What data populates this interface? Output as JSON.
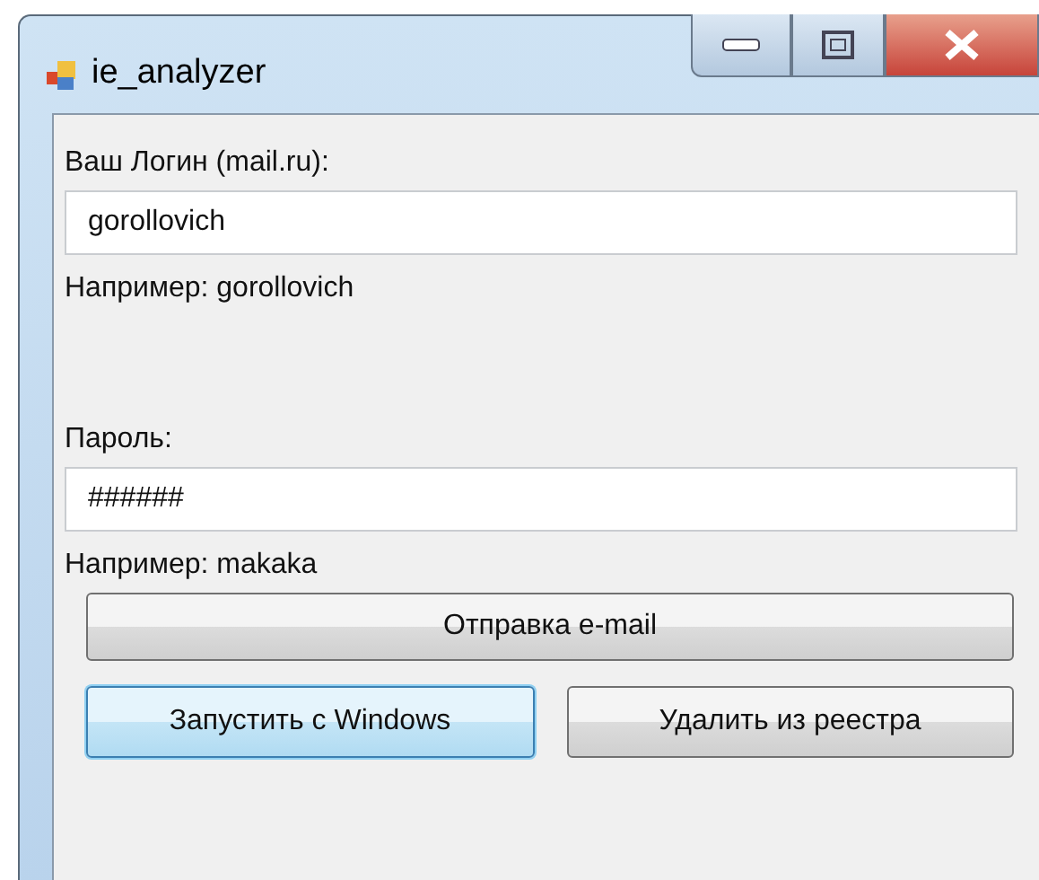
{
  "window": {
    "title": "ie_analyzer"
  },
  "fields": [
    {
      "label": "Ваш Логин (mail.ru):",
      "value": "gorollovich",
      "hint": "Например: gorollovich"
    },
    {
      "label": "Пароль:",
      "value": "######",
      "hint": "Например: makaka"
    }
  ],
  "send_button": {
    "label": "Отправка e-mail",
    "focused": false
  },
  "buttons": [
    {
      "label": "Запустить с Windows",
      "focused": true
    },
    {
      "label": "Удалить из реестра",
      "focused": false
    }
  ]
}
